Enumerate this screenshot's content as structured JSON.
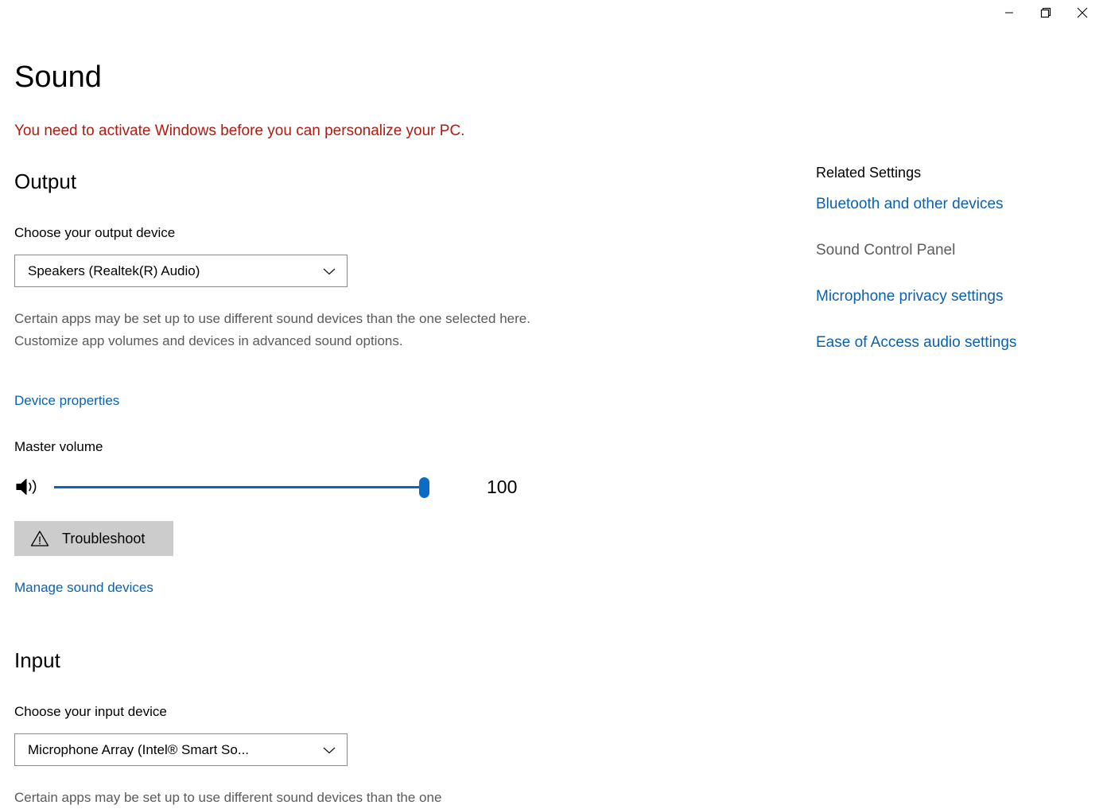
{
  "window": {
    "title": "Sound",
    "controls": [
      {
        "name": "minimize",
        "label": "Minimize"
      },
      {
        "name": "restore",
        "label": "Restore Down"
      },
      {
        "name": "close",
        "label": "Close"
      }
    ]
  },
  "page": {
    "title": "Sound",
    "activation_warning": "You need to activate Windows before you can personalize your PC."
  },
  "output": {
    "heading": "Output",
    "device_label": "Choose your output device",
    "device_value": "Speakers (Realtek(R) Audio)",
    "description": "Certain apps may be set up to use different sound devices than the one selected here. Customize app volumes and devices in advanced sound options.",
    "device_properties_link": "Device properties",
    "master_volume_label": "Master volume",
    "master_volume_value": "100",
    "master_volume_percent": 100,
    "volume_icon": "speaker-waves-icon",
    "troubleshoot_button": "Troubleshoot",
    "troubleshoot_icon": "warning-triangle-icon",
    "manage_sound_devices_link": "Manage sound devices"
  },
  "input": {
    "heading": "Input",
    "device_label": "Choose your input device",
    "device_value": "Microphone Array (Intel® Smart So...",
    "description": "Certain apps may be set up to use different sound devices than the one"
  },
  "related_settings": {
    "title": "Related Settings",
    "links": [
      {
        "label": "Bluetooth and other devices",
        "enabled": true
      },
      {
        "label": "Sound Control Panel",
        "enabled": false
      },
      {
        "label": "Microphone privacy settings",
        "enabled": true
      },
      {
        "label": "Ease of Access audio settings",
        "enabled": true
      }
    ]
  },
  "colors": {
    "link_blue": "#0a61b0",
    "warning_red": "#b01a11",
    "slider_blue": "#0a65b8",
    "button_grey": "#cccccc",
    "muted_text": "#5a5a5a"
  }
}
